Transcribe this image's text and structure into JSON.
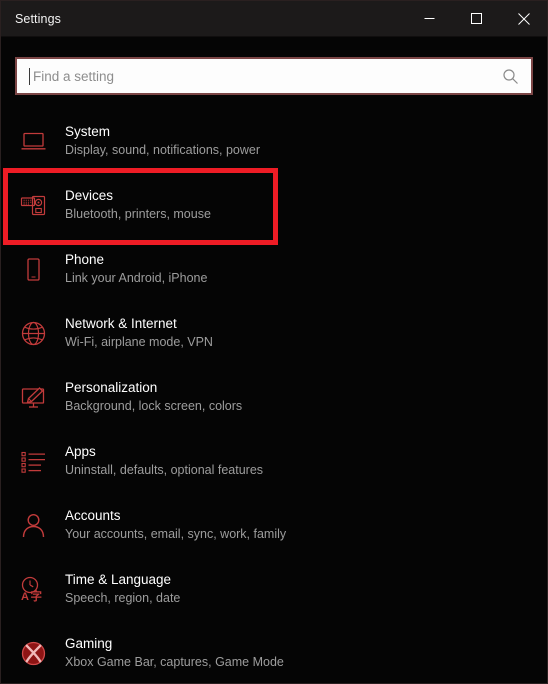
{
  "window": {
    "title": "Settings",
    "controls": [
      {
        "name": "minimize",
        "glyph": "minimize-icon",
        "label": "Minimize"
      },
      {
        "name": "maximize",
        "glyph": "maximize-icon",
        "label": "Maximize"
      },
      {
        "name": "close",
        "glyph": "close-icon",
        "label": "Close"
      }
    ]
  },
  "search": {
    "placeholder": "Find a setting",
    "value": "",
    "icon": "search-icon"
  },
  "highlight": {
    "target": "Devices",
    "color": "#ee1c25",
    "border_width_px": 5
  },
  "colors": {
    "accent_red": "#ee1c25",
    "icon_red": "#c23b3b",
    "titlebar": "#1c1a1a",
    "background": "#050505",
    "title_text": "#ffffff",
    "subtitle_text": "#9d9d9d",
    "search_border": "#7c4646",
    "search_field": "#fdfdfd"
  },
  "settings_items": [
    {
      "icon": "laptop-icon",
      "title": "System",
      "subtitle": "Display, sound, notifications, power"
    },
    {
      "icon": "devices-icon",
      "title": "Devices",
      "subtitle": "Bluetooth, printers, mouse"
    },
    {
      "icon": "phone-icon",
      "title": "Phone",
      "subtitle": "Link your Android, iPhone"
    },
    {
      "icon": "globe-icon",
      "title": "Network & Internet",
      "subtitle": "Wi-Fi, airplane mode, VPN"
    },
    {
      "icon": "paintbrush-monitor-icon",
      "title": "Personalization",
      "subtitle": "Background, lock screen, colors"
    },
    {
      "icon": "apps-list-icon",
      "title": "Apps",
      "subtitle": "Uninstall, defaults, optional features"
    },
    {
      "icon": "person-icon",
      "title": "Accounts",
      "subtitle": "Your accounts, email, sync, work, family"
    },
    {
      "icon": "clock-language-icon",
      "title": "Time & Language",
      "subtitle": "Speech, region, date"
    },
    {
      "icon": "xbox-icon",
      "title": "Gaming",
      "subtitle": "Xbox Game Bar, captures, Game Mode"
    }
  ]
}
